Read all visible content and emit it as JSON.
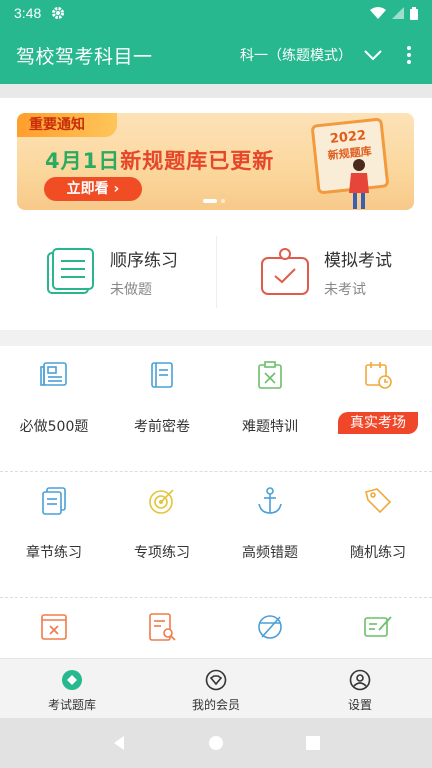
{
  "status": {
    "time": "3:48"
  },
  "app": {
    "title": "驾校驾考科目一",
    "mode": "科一（练题模式）"
  },
  "banner": {
    "tag": "重要通知",
    "headline_date": "4月1日",
    "headline_rest": "新规题库已更新",
    "cta": "立即看 ›",
    "board_year": "2022",
    "board_text": "新规题库"
  },
  "practice": [
    {
      "name": "顺序练习",
      "sub": "未做题"
    },
    {
      "name": "模拟考试",
      "sub": "未考试"
    }
  ],
  "grid": {
    "row1": [
      {
        "label": "必做500题",
        "icon": "newspaper-icon"
      },
      {
        "label": "考前密卷",
        "icon": "booklet-icon"
      },
      {
        "label": "难题特训",
        "icon": "clipboard-x-icon"
      },
      {
        "label": "真实考场",
        "icon": "calendar-clock-icon",
        "badge": true
      }
    ],
    "row2": [
      {
        "label": "章节练习",
        "icon": "document-stack-icon"
      },
      {
        "label": "专项练习",
        "icon": "target-icon"
      },
      {
        "label": "高频错题",
        "icon": "anchor-icon"
      },
      {
        "label": "随机练习",
        "icon": "tag-icon"
      }
    ],
    "row3": [
      {
        "icon": "wrong-book-icon"
      },
      {
        "icon": "search-document-icon"
      },
      {
        "icon": "no-entry-icon"
      },
      {
        "icon": "edit-note-icon"
      }
    ]
  },
  "tabs": [
    {
      "label": "考试题库",
      "active": true
    },
    {
      "label": "我的会员",
      "active": false
    },
    {
      "label": "设置",
      "active": false
    }
  ],
  "colors": {
    "primary": "#27b88f",
    "accent": "#f0472a"
  }
}
